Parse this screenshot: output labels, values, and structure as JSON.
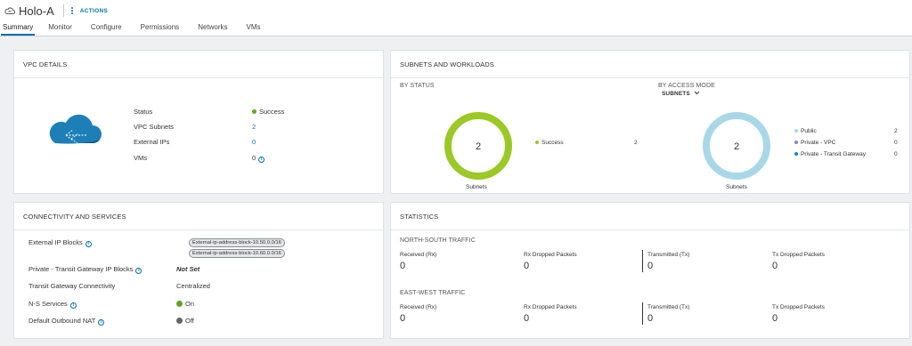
{
  "header": {
    "title": "Holo-A",
    "actions_label": "ACTIONS",
    "tabs": [
      {
        "label": "Summary",
        "active": true
      },
      {
        "label": "Monitor"
      },
      {
        "label": "Configure"
      },
      {
        "label": "Permissions"
      },
      {
        "label": "Networks"
      },
      {
        "label": "VMs"
      }
    ]
  },
  "vpc_details": {
    "title": "VPC DETAILS",
    "status_label": "Status",
    "status_value": "Success",
    "subnets_label": "VPC Subnets",
    "subnets_value": "2",
    "external_ips_label": "External IPs",
    "external_ips_value": "0",
    "vms_label": "VMs",
    "vms_value": "0"
  },
  "subnets_workloads": {
    "title": "SUBNETS AND WORKLOADS",
    "by_status": {
      "heading": "BY STATUS",
      "total": "2",
      "caption": "Subnets",
      "legend": [
        {
          "label": "Success",
          "count": "2",
          "color": "#9bc925"
        }
      ]
    },
    "by_access_mode": {
      "heading": "BY ACCESS MODE",
      "dropdown_label": "SUBNETS",
      "total": "2",
      "caption": "Subnets",
      "legend": [
        {
          "label": "Public",
          "count": "2",
          "color": "#a8d8e8"
        },
        {
          "label": "Private - VPC",
          "count": "0",
          "color": "#7b84d0"
        },
        {
          "label": "Private - Transit Gateway",
          "count": "0",
          "color": "#1a85c8"
        }
      ]
    }
  },
  "connectivity": {
    "title": "CONNECTIVITY AND SERVICES",
    "external_ip_blocks_label": "External IP Blocks",
    "external_ip_blocks": [
      "External-ip-address-block-10.50.0.0/16",
      "External-ip-address-block-10.60.0.0/16"
    ],
    "transit_gw_ip_blocks_label": "Private - Transit Gateway IP Blocks",
    "transit_gw_ip_blocks_value": "Not Set",
    "transit_gw_conn_label": "Transit Gateway Connectivity",
    "transit_gw_conn_value": "Centralized",
    "ns_services_label": "N-S Services",
    "ns_services_value": "On",
    "outbound_nat_label": "Default Outbound NAT",
    "outbound_nat_value": "Off"
  },
  "statistics": {
    "title": "STATISTICS",
    "north_south": {
      "heading": "NORTH-SOUTH TRAFFIC",
      "received_label": "Received (Rx)",
      "received_value": "0",
      "rx_dropped_label": "Rx Dropped Packets",
      "rx_dropped_value": "0",
      "transmitted_label": "Transmitted (Tx)",
      "transmitted_value": "0",
      "tx_dropped_label": "Tx Dropped Packets",
      "tx_dropped_value": "0"
    },
    "east_west": {
      "heading": "EAST-WEST TRAFFIC",
      "received_label": "Received (Rx)",
      "received_value": "0",
      "rx_dropped_label": "Rx Dropped Packets",
      "rx_dropped_value": "0",
      "transmitted_label": "Transmitted (Tx)",
      "transmitted_value": "0",
      "tx_dropped_label": "Tx Dropped Packets",
      "tx_dropped_value": "0"
    }
  },
  "colors": {
    "accent": "#0072a3",
    "success": "#9bc925",
    "on": "#62a420",
    "off": "#666666",
    "public_ring": "#a8d8e8"
  }
}
